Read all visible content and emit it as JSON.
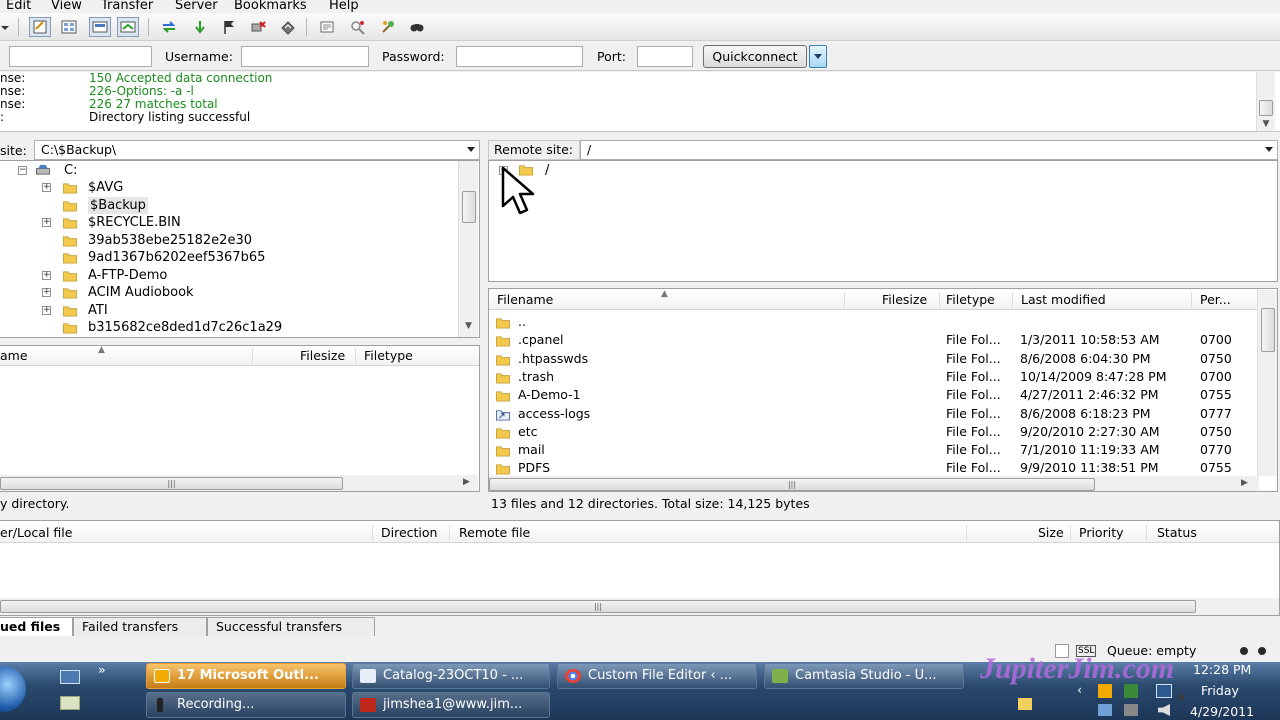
{
  "menu": [
    "Edit",
    "View",
    "Transfer",
    "Server",
    "Bookmarks",
    "Help"
  ],
  "quickconnect": {
    "username_label": "Username:",
    "password_label": "Password:",
    "port_label": "Port:",
    "button_label": "Quickconnect"
  },
  "log": [
    {
      "key": "nse:",
      "text": "150 Accepted data connection",
      "color": "#1c8a1c"
    },
    {
      "key": "nse:",
      "text": "226-Options: -a -l",
      "color": "#1c8a1c"
    },
    {
      "key": "nse:",
      "text": "226 27 matches total",
      "color": "#1c8a1c"
    },
    {
      "key": ":",
      "text": "Directory listing successful",
      "color": "#000000"
    }
  ],
  "local": {
    "site_label": "site:",
    "path": "C:\\$Backup\\",
    "drive": "C:",
    "tree": [
      "$AVG",
      "$Backup",
      "$RECYCLE.BIN",
      "39ab538ebe25182e2e30",
      "9ad1367b6202eef5367b65",
      "A-FTP-Demo",
      "ACIM Audiobook",
      "ATI",
      "b315682ce8ded1d7c26c1a29"
    ],
    "headers": {
      "name": "ame",
      "filesize": "Filesize",
      "filetype": "Filetype"
    },
    "status": "y directory."
  },
  "remote": {
    "site_label": "Remote site:",
    "path": "/",
    "root": "/",
    "headers": {
      "filename": "Filename",
      "filesize": "Filesize",
      "filetype": "Filetype",
      "modified": "Last modified",
      "perm": "Per..."
    },
    "files": [
      {
        "name": "..",
        "type": "",
        "modified": "",
        "perm": ""
      },
      {
        "name": ".cpanel",
        "type": "File Fol...",
        "modified": "1/3/2011 10:58:53 AM",
        "perm": "0700"
      },
      {
        "name": ".htpasswds",
        "type": "File Fol...",
        "modified": "8/6/2008 6:04:30 PM",
        "perm": "0750"
      },
      {
        "name": ".trash",
        "type": "File Fol...",
        "modified": "10/14/2009 8:47:28 PM",
        "perm": "0700"
      },
      {
        "name": "A-Demo-1",
        "type": "File Fol...",
        "modified": "4/27/2011 2:46:32 PM",
        "perm": "0755"
      },
      {
        "name": "access-logs",
        "type": "File Fol...",
        "modified": "8/6/2008 6:18:23 PM",
        "perm": "0777"
      },
      {
        "name": "etc",
        "type": "File Fol...",
        "modified": "9/20/2010 2:27:30 AM",
        "perm": "0750"
      },
      {
        "name": "mail",
        "type": "File Fol...",
        "modified": "7/1/2010 11:19:33 AM",
        "perm": "0770"
      },
      {
        "name": "PDFS",
        "type": "File Fol...",
        "modified": "9/9/2010 11:38:51 PM",
        "perm": "0755"
      }
    ],
    "status": "13 files and 12 directories. Total size: 14,125 bytes"
  },
  "queue": {
    "headers": {
      "local": "er/Local file",
      "direction": "Direction",
      "remote": "Remote file",
      "size": "Size",
      "priority": "Priority",
      "status": "Status"
    },
    "tabs": [
      "ued files",
      "Failed transfers",
      "Successful transfers"
    ],
    "queue_status": "Queue: empty"
  },
  "taskbar": {
    "buttons_top": [
      "17 Microsoft Outl...",
      "Catalog-23OCT10 - ...",
      "Custom File Editor ‹ ...",
      "Camtasia Studio - U..."
    ],
    "buttons_bottom": [
      "Recording...",
      "jimshea1@www.jim..."
    ],
    "watermark": "JupiterJim.com",
    "clock_time": "12:28 PM",
    "clock_day": "Friday",
    "clock_date": "4/29/2011"
  }
}
